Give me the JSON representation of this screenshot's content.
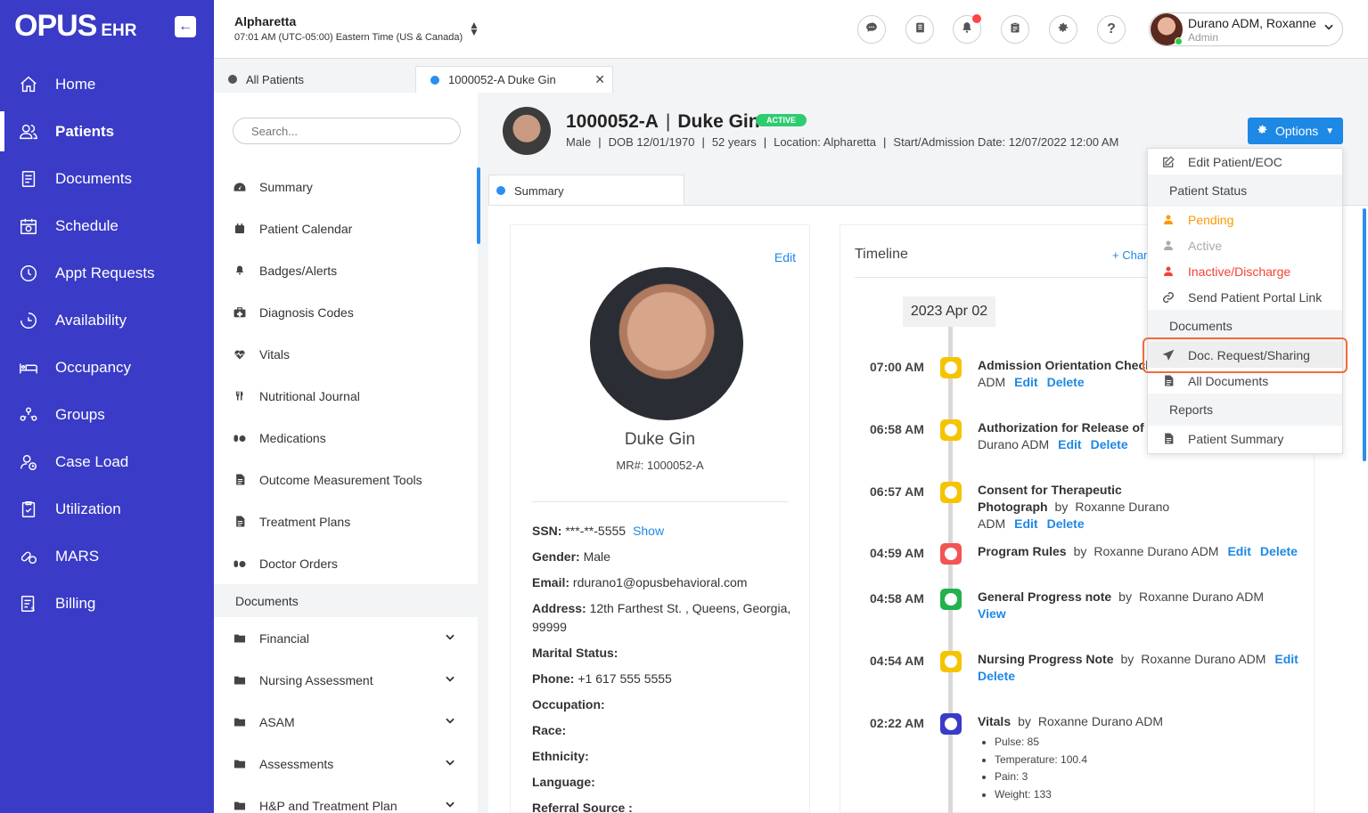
{
  "brand": {
    "logo_main": "OPUS",
    "logo_sub": "EHR",
    "collapse_icon": "arrow-left-icon"
  },
  "sidebar": {
    "items": [
      {
        "label": "Home",
        "icon": "home-icon",
        "active": false
      },
      {
        "label": "Patients",
        "icon": "users-icon",
        "active": true
      },
      {
        "label": "Documents",
        "icon": "documents-icon",
        "active": false
      },
      {
        "label": "Schedule",
        "icon": "calendar-icon",
        "active": false
      },
      {
        "label": "Appt Requests",
        "icon": "clock-icon",
        "active": false
      },
      {
        "label": "Availability",
        "icon": "availability-icon",
        "active": false
      },
      {
        "label": "Occupancy",
        "icon": "bed-icon",
        "active": false
      },
      {
        "label": "Groups",
        "icon": "groups-icon",
        "active": false
      },
      {
        "label": "Case Load",
        "icon": "case-load-icon",
        "active": false
      },
      {
        "label": "Utilization",
        "icon": "clipboard-check-icon",
        "active": false
      },
      {
        "label": "MARS",
        "icon": "pills-icon",
        "active": false
      },
      {
        "label": "Billing",
        "icon": "billing-icon",
        "active": false
      }
    ]
  },
  "header": {
    "location_name": "Alpharetta",
    "location_time": "07:01 AM (UTC-05:00) Eastern Time (US & Canada)",
    "user_name": "Durano ADM, Roxanne",
    "user_role": "Admin"
  },
  "tabs": [
    {
      "label": "All Patients",
      "color": "#555555"
    },
    {
      "label": "1000052-A Duke Gin",
      "color": "#2d8cf0"
    }
  ],
  "left_panel": {
    "search_placeholder": "Search...",
    "menu": [
      {
        "label": "Summary",
        "icon": "dashboard-icon"
      },
      {
        "label": "Patient Calendar",
        "icon": "calendar-icon"
      },
      {
        "label": "Badges/Alerts",
        "icon": "bell-icon"
      },
      {
        "label": "Diagnosis Codes",
        "icon": "medkit-icon"
      },
      {
        "label": "Vitals",
        "icon": "heartbeat-icon"
      },
      {
        "label": "Nutritional Journal",
        "icon": "utensils-icon"
      },
      {
        "label": "Medications",
        "icon": "pills-icon"
      },
      {
        "label": "Outcome Measurement Tools",
        "icon": "file-icon"
      },
      {
        "label": "Treatment Plans",
        "icon": "file-icon"
      },
      {
        "label": "Doctor Orders",
        "icon": "pills-icon"
      }
    ],
    "documents_header": "Documents",
    "folders": [
      "Financial",
      "Nursing Assessment",
      "ASAM",
      "Assessments",
      "H&P and Treatment Plan"
    ]
  },
  "patient": {
    "id": "1000052-A",
    "name": "Duke Gin",
    "status": "ACTIVE",
    "gender": "Male",
    "dob": "DOB 12/01/1970",
    "age": "52 years",
    "location": "Location: Alpharetta",
    "start_date": "Start/Admission Date: 12/07/2022 12:00 AM",
    "options_label": "Options"
  },
  "summary_tab": "Summary",
  "profile": {
    "edit_label": "Edit",
    "name": "Duke Gin",
    "mr": "MR#: 1000052-A",
    "ssn_label": "SSN:",
    "ssn_value": "***-**-5555",
    "ssn_show": "Show",
    "gender_label": "Gender:",
    "gender_value": "Male",
    "email_label": "Email:",
    "email_value": "rdurano1@opusbehavioral.com",
    "address_label": "Address:",
    "address_value": "12th Farthest St. , Queens, Georgia, 99999",
    "marital_label": "Marital Status:",
    "phone_label": "Phone:",
    "phone_value": "+1 617 555 5555",
    "occupation_label": "Occupation:",
    "race_label": "Race:",
    "ethnicity_label": "Ethnicity:",
    "language_label": "Language:",
    "referral_label": "Referral Source :"
  },
  "timeline": {
    "title": "Timeline",
    "change_label": "+ Char",
    "date": "2023 Apr 02",
    "events": [
      {
        "time": "07:00 AM",
        "title": "Admission Orientation Checkl",
        "by": "",
        "author": "ADM",
        "edit": "Edit",
        "delete": "Delete",
        "color": "#f5c400"
      },
      {
        "time": "06:58 AM",
        "title": "Authorization for Release of Inf",
        "by": "",
        "author": "Durano ADM",
        "edit": "Edit",
        "delete": "Delete",
        "color": "#f5c400"
      },
      {
        "time": "06:57 AM",
        "title": "Consent for Therapeutic Photograph",
        "by": "by",
        "author": "Roxanne Durano ADM",
        "edit": "Edit",
        "delete": "Delete",
        "color": "#f5c400"
      },
      {
        "time": "04:59 AM",
        "title": "Program Rules",
        "by": "by",
        "author": "Roxanne Durano ADM",
        "edit": "Edit",
        "delete": "Delete",
        "color": "#f25555"
      },
      {
        "time": "04:58 AM",
        "title": "General Progress note",
        "by": "by",
        "author": "Roxanne Durano ADM",
        "view": "View",
        "color": "#22b14c"
      },
      {
        "time": "04:54 AM",
        "title": "Nursing Progress Note",
        "by": "by",
        "author": "Roxanne Durano ADM",
        "edit": "Edit",
        "delete": "Delete",
        "color": "#f5c400"
      },
      {
        "time": "02:22 AM",
        "title": "Vitals",
        "by": "by",
        "author": "Roxanne Durano ADM",
        "color": "#3a3bc6",
        "list": [
          "Pulse: 85",
          "Temperature: 100.4",
          "Pain: 3",
          "Weight: 133"
        ]
      }
    ]
  },
  "options_menu": {
    "edit_patient": "Edit Patient/EOC",
    "status_header": "Patient Status",
    "pending": "Pending",
    "active": "Active",
    "inactive": "Inactive/Discharge",
    "send_link": "Send Patient Portal Link",
    "documents_header": "Documents",
    "doc_request": "Doc. Request/Sharing",
    "all_documents": "All Documents",
    "reports_header": "Reports",
    "patient_summary": "Patient Summary"
  },
  "colors": {
    "sidebar": "#3a3bc6",
    "accent": "#1e88e5",
    "pending": "#ff9800",
    "inactive": "#f44336",
    "active_badge": "#2ecc71",
    "highlight": "#f26b3a"
  }
}
